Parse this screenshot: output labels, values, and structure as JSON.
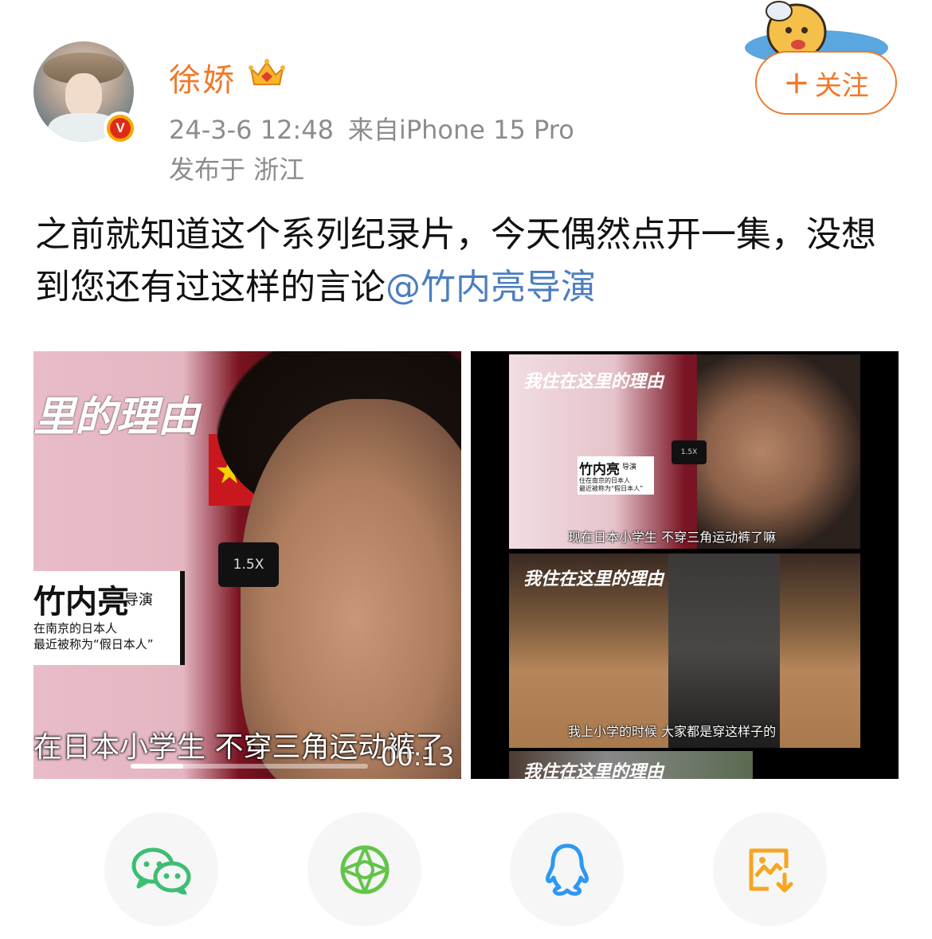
{
  "user": {
    "name": "徐娇",
    "verified_badge": "V",
    "timestamp": "24-3-6 12:48",
    "source": "来自iPhone 15 Pro",
    "location": "发布于 浙江"
  },
  "follow_button": {
    "label": "关注",
    "plus": "+"
  },
  "post": {
    "text": "之前就知道这个系列纪录片，今天偶然点开一集，没想到您还有过这样的言论",
    "mention": "@竹内亮导演"
  },
  "media_left": {
    "title": "里的理由",
    "speed": "1.5X",
    "name": "竹内亮",
    "role": "导演",
    "desc_line1": "在南京的日本人",
    "desc_line2": "最近被称为“假日本人”",
    "subtitle": "在日本小学生  不穿三角运动裤了",
    "duration": "00:13",
    "progress_fraction": 0.22
  },
  "media_right": {
    "title": "我住在这里的理由",
    "speed": "1.5X",
    "name": "竹内亮",
    "role": "导演",
    "desc_line1": "住在南京的日本人",
    "desc_line2": "最近被称为“假日本人”",
    "subtitle_top": "现在日本小学生  不穿三角运动裤了嘛",
    "subtitle_bottom": "我上小学的时候  大家都是穿这样子的"
  },
  "share": [
    {
      "name": "wechat",
      "color": "#3cbe73"
    },
    {
      "name": "moments",
      "color": "#62c548"
    },
    {
      "name": "qq",
      "color": "#2e98f2"
    },
    {
      "name": "save-image",
      "color": "#f6a623"
    }
  ],
  "colors": {
    "accent": "#f0782a",
    "link": "#4c7ec0",
    "meta": "#8c8c8c"
  }
}
